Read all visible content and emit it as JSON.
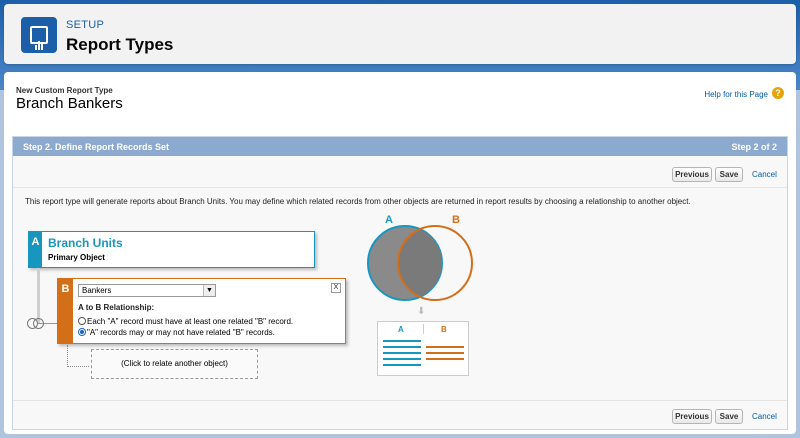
{
  "header": {
    "setup_label": "SETUP",
    "title": "Report Types",
    "icon": "report-types-icon"
  },
  "page": {
    "crumb": "New Custom Report Type",
    "title": "Branch Bankers",
    "help_link": "Help for this Page",
    "help_icon": "?"
  },
  "step": {
    "title": "Step 2. Define Report Records Set",
    "progress": "Step 2 of 2",
    "buttons": {
      "previous": "Previous",
      "save": "Save",
      "cancel": "Cancel"
    },
    "description": "This report type will generate reports about Branch Units. You may define which related records from other objects are returned in report results by choosing a relationship to another object."
  },
  "object_a": {
    "tag": "A",
    "name": "Branch Units",
    "subtitle": "Primary Object"
  },
  "object_b": {
    "tag": "B",
    "selected": "Bankers",
    "close": "X",
    "relationship_label": "A to B Relationship:",
    "option_1": "Each \"A\" record must have at least one related \"B\" record.",
    "option_2": "\"A\" records may or may not have related \"B\" records.",
    "selected_option": 2
  },
  "add_object": "(Click to relate another object)",
  "venn": {
    "label_a": "A",
    "label_b": "B",
    "color_a": "#1797c0",
    "color_b": "#d36f19"
  },
  "table_icon": {
    "col_a": "A",
    "col_b": "B"
  }
}
